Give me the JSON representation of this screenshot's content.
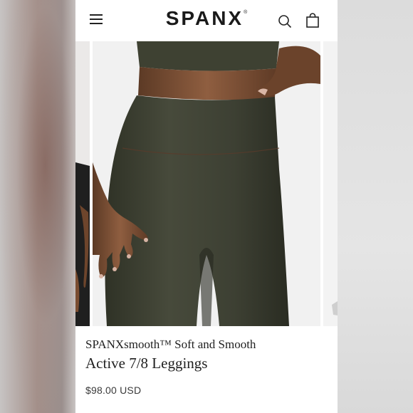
{
  "header": {
    "brand": "SPANX",
    "trademark": "®",
    "icons": [
      "menu-icon",
      "search-icon",
      "shopping-bag-icon"
    ]
  },
  "gallery": {
    "image_description_icon": "product-photo"
  },
  "product": {
    "title_line1": "SPANXsmooth™ Soft and Smooth",
    "title_line2": "Active 7/8 Leggings",
    "price": "$98.00 USD"
  },
  "colors": {
    "legging": "#3f4234",
    "skin": "#8a5a3c",
    "text": "#1f1f1f"
  }
}
